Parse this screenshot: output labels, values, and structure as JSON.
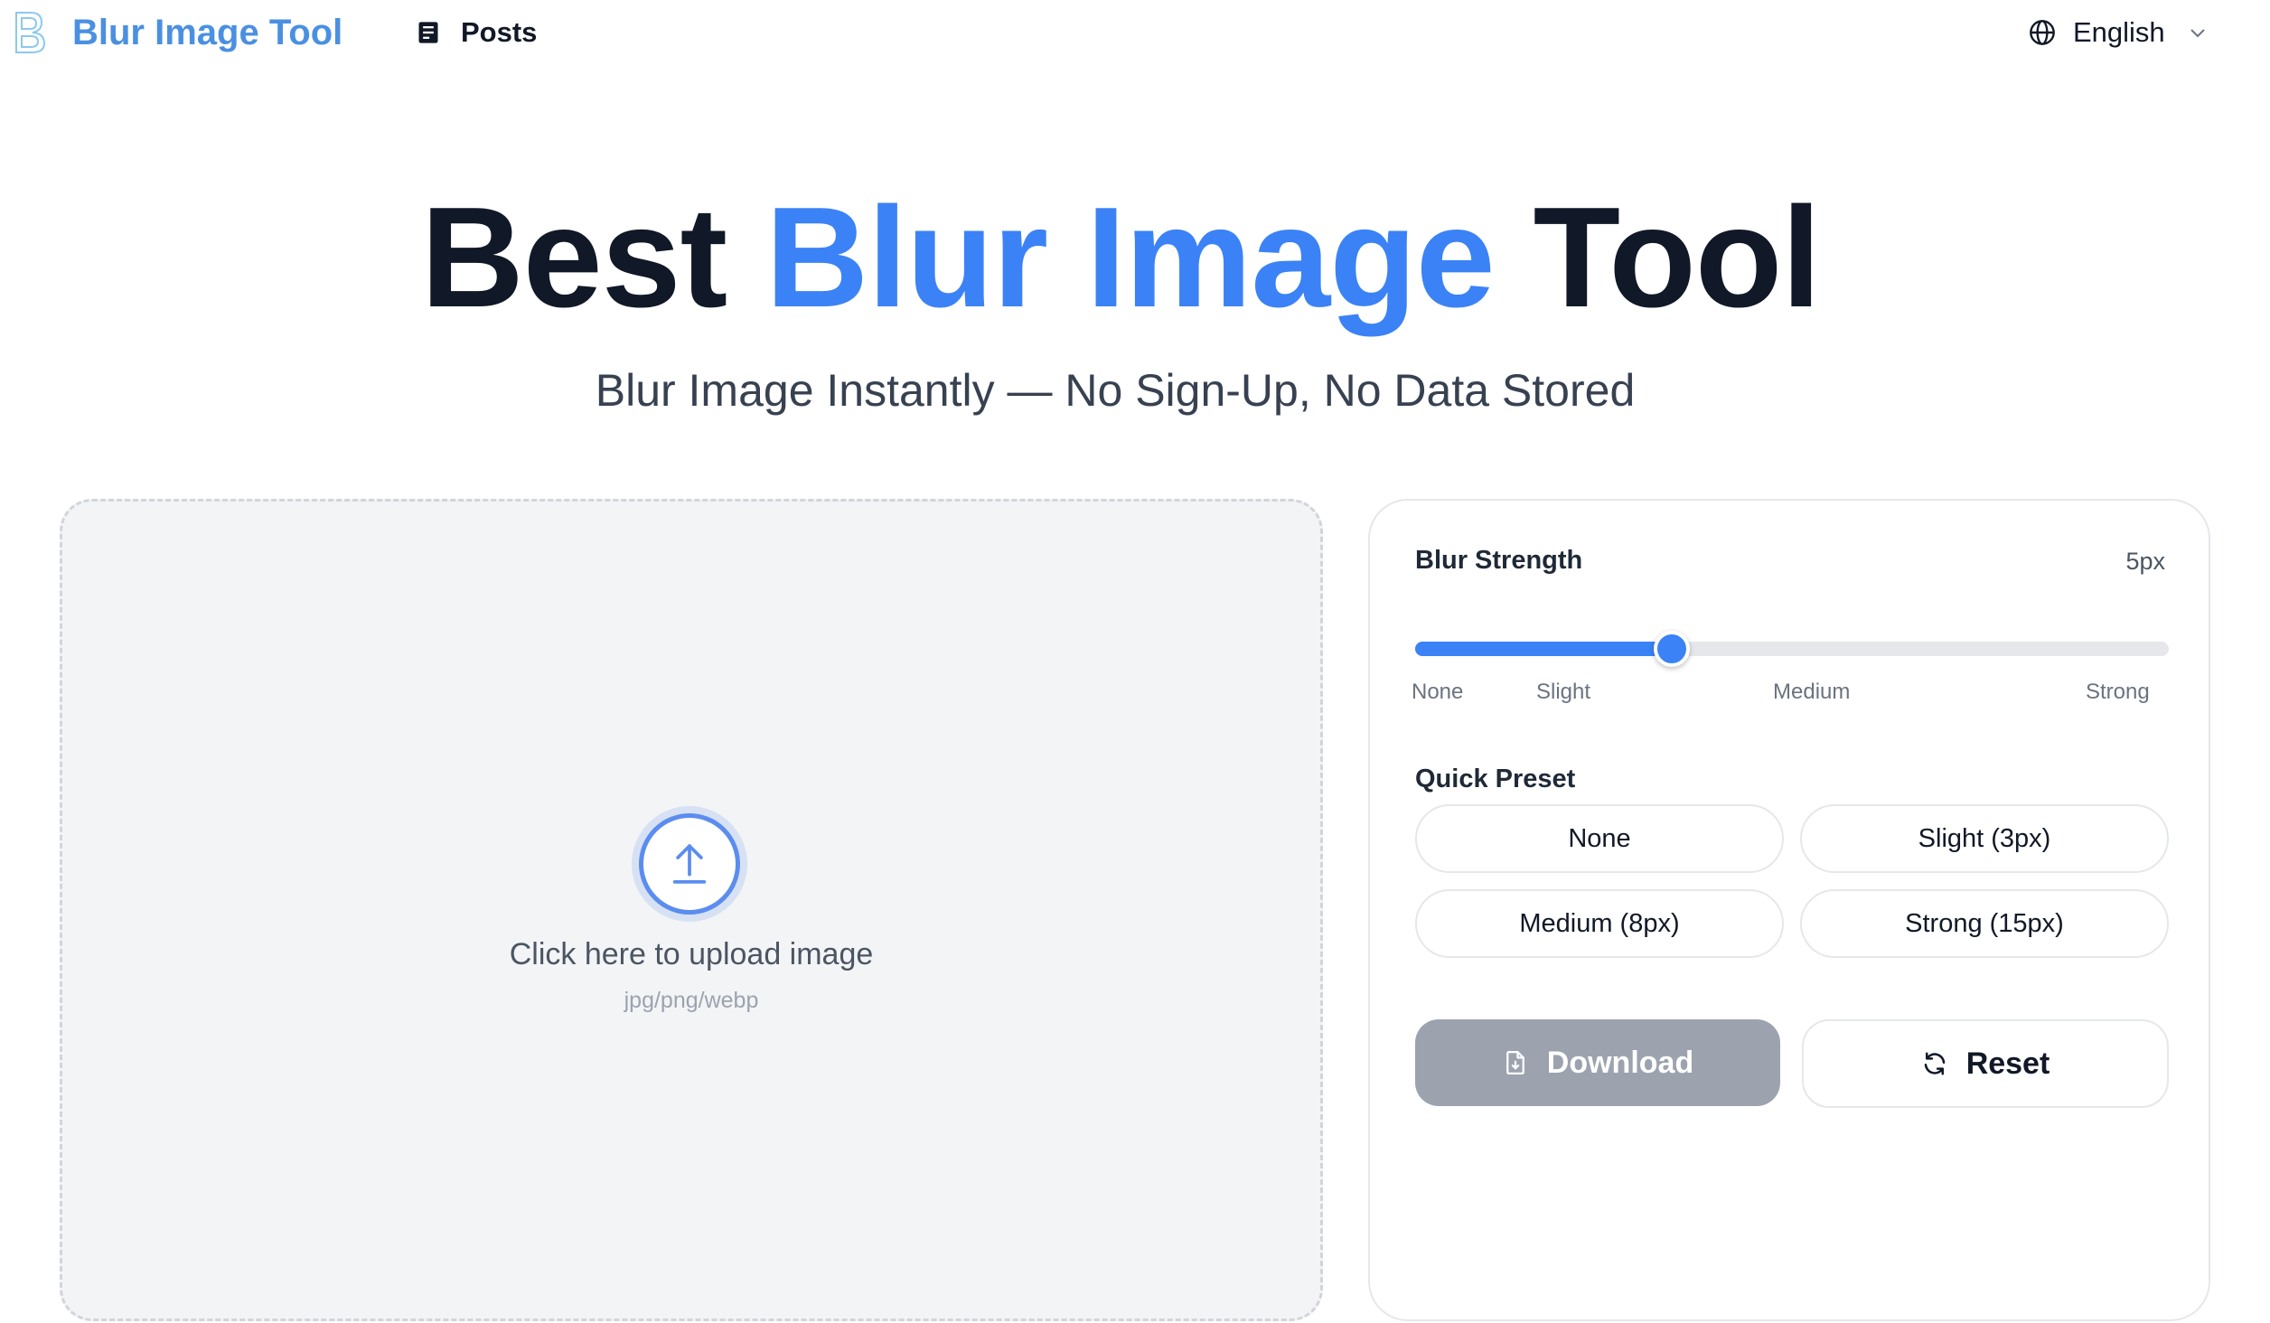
{
  "header": {
    "logo_text": "Blur Image Tool",
    "nav": {
      "posts_label": "Posts"
    },
    "language": "English"
  },
  "hero": {
    "title_lead": "Best",
    "title_accent": "Blur Image",
    "title_tail": "Tool",
    "subtitle": "Blur Image Instantly — No Sign-Up, No Data Stored"
  },
  "upload": {
    "title": "Click here to upload image",
    "hint": "jpg/png/webp"
  },
  "controls": {
    "blur": {
      "label": "Blur Strength",
      "value_text": "5px",
      "value_fraction": 0.34,
      "ticks": [
        "None",
        "Slight",
        "Medium",
        "Strong"
      ]
    },
    "presets": {
      "label": "Quick Preset",
      "items": [
        "None",
        "Slight (3px)",
        "Medium (8px)",
        "Strong (15px)"
      ]
    },
    "download_label": "Download",
    "reset_label": "Reset"
  },
  "colors": {
    "accent": "#3b82f6",
    "logo": "#4a90e2",
    "download_disabled": "#9ca3af"
  }
}
